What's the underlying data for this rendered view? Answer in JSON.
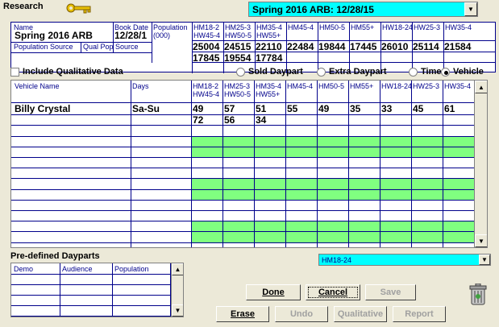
{
  "header": {
    "title": "Research"
  },
  "book_select": {
    "value": "Spring 2016 ARB: 12/28/15"
  },
  "book_info": {
    "name_label": "Name",
    "name_value": "Spring 2016 ARB",
    "book_date_label": "Book Date",
    "book_date_value": "12/28/1",
    "population_label": "Population\n(000)",
    "pop_source_label": "Population Source",
    "qual_pop_source_label": "Qual Pop Source"
  },
  "demo_columns": [
    {
      "header": "HM18-2\nHW45-4",
      "pop1": "25004",
      "pop2": "17845"
    },
    {
      "header": "HM25-3\nHW50-5",
      "pop1": "24515",
      "pop2": "19554"
    },
    {
      "header": "HM35-4\nHW55+",
      "pop1": "22110",
      "pop2": "17784"
    },
    {
      "header": "HM45-4",
      "pop1": "22484",
      "pop2": ""
    },
    {
      "header": "HM50-5",
      "pop1": "19844",
      "pop2": ""
    },
    {
      "header": "HM55+",
      "pop1": "17445",
      "pop2": ""
    },
    {
      "header": "HW18-24",
      "pop1": "26010",
      "pop2": ""
    },
    {
      "header": "HW25-3",
      "pop1": "25114",
      "pop2": ""
    },
    {
      "header": "HW35-4",
      "pop1": "21584",
      "pop2": ""
    }
  ],
  "options": {
    "include_qual_label": "Include Qualitative Data",
    "include_qual_checked": false,
    "radios": [
      {
        "label": "Sold Daypart",
        "selected": false
      },
      {
        "label": "Extra Daypart",
        "selected": false
      },
      {
        "label": "Time",
        "selected": false
      },
      {
        "label": "Vehicle",
        "selected": true
      }
    ]
  },
  "grid": {
    "col_vehicle": "Vehicle Name",
    "col_days": "Days",
    "rows": [
      {
        "vehicle": "Billy Crystal",
        "days": "Sa-Su",
        "line1": [
          "49",
          "57",
          "51",
          "55",
          "49",
          "35",
          "33",
          "45",
          "61"
        ],
        "line2": [
          "72",
          "56",
          "34",
          "",
          "",
          "",
          "",
          "",
          ""
        ]
      }
    ]
  },
  "predefined": {
    "label": "Pre-defined Dayparts",
    "columns": [
      "Demo",
      "Audience",
      "Population"
    ]
  },
  "demo_select": {
    "value": "HM18-24"
  },
  "buttons": {
    "done": "Done",
    "cancel": "Cancel",
    "save": "Save",
    "erase": "Erase",
    "undo": "Undo",
    "qualitative": "Qualitative",
    "report": "Report"
  },
  "colors": {
    "accent_cyan": "#00ffff",
    "highlight_green": "#80ff80",
    "grid_blue": "#00008b"
  }
}
